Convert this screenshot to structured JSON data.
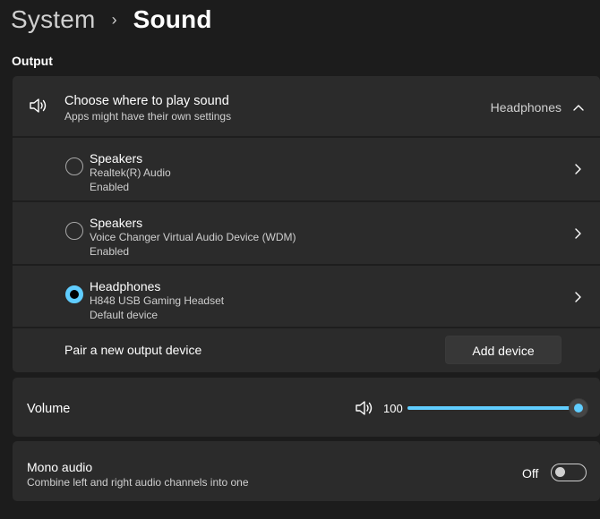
{
  "breadcrumb": {
    "parent": "System",
    "separator": "›",
    "current": "Sound"
  },
  "section": {
    "output_label": "Output"
  },
  "output": {
    "title": "Choose where to play sound",
    "subtitle": "Apps might have their own settings",
    "selected_device": "Headphones",
    "expanded": true,
    "devices": [
      {
        "name": "Speakers",
        "description": "Realtek(R) Audio",
        "status": "Enabled",
        "selected": false
      },
      {
        "name": "Speakers",
        "description": "Voice Changer Virtual Audio Device (WDM)",
        "status": "Enabled",
        "selected": false
      },
      {
        "name": "Headphones",
        "description": "H848 USB Gaming Headset",
        "status": "Default device",
        "selected": true
      }
    ],
    "pair_label": "Pair a new output device",
    "add_button_label": "Add device"
  },
  "volume": {
    "label": "Volume",
    "value": "100",
    "level": 1.0,
    "icon": "speaker-icon"
  },
  "mono": {
    "title": "Mono audio",
    "subtitle": "Combine left and right audio channels into one",
    "state_label": "Off",
    "enabled": false
  },
  "colors": {
    "background": "#1c1c1c",
    "card": "#2b2b2b",
    "accent": "#60cdff",
    "text_primary": "#ffffff",
    "text_secondary": "#cfcfcf"
  }
}
